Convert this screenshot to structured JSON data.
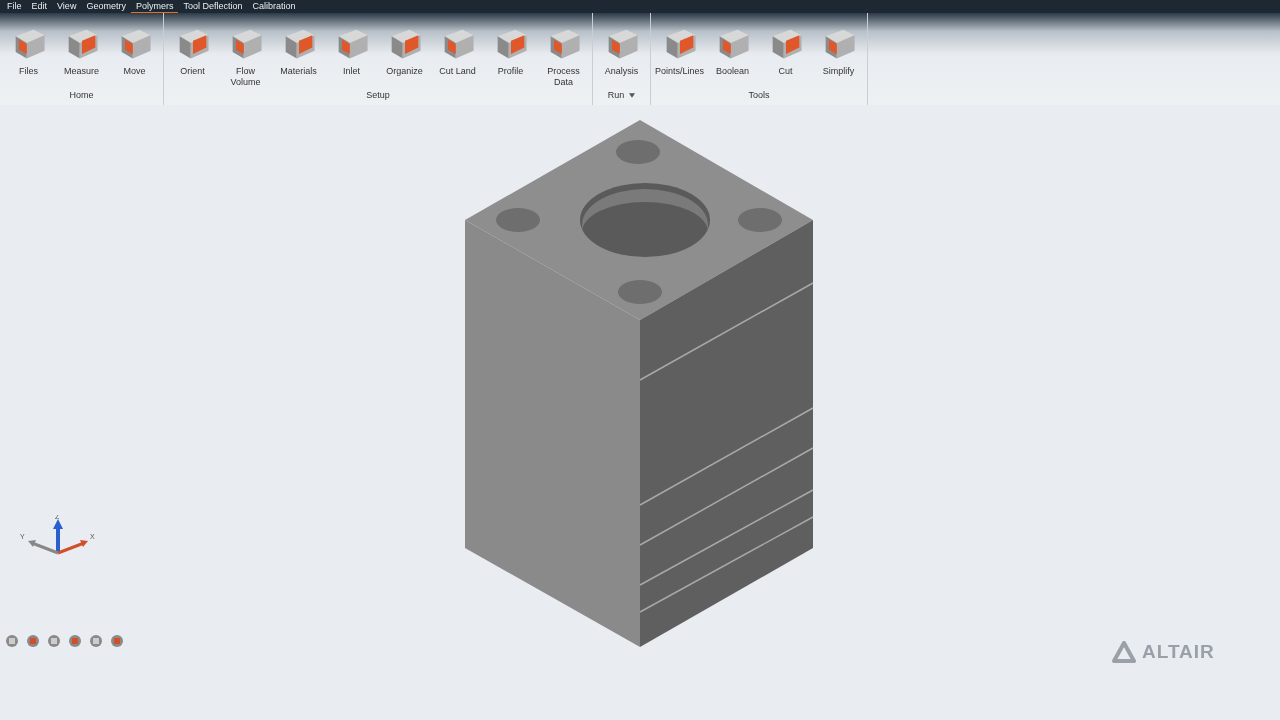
{
  "menu": [
    {
      "label": "File",
      "selected": false
    },
    {
      "label": "Edit",
      "selected": false
    },
    {
      "label": "View",
      "selected": false
    },
    {
      "label": "Geometry",
      "selected": false
    },
    {
      "label": "Polymers",
      "selected": true
    },
    {
      "label": "Tool Deflection",
      "selected": false
    },
    {
      "label": "Calibration",
      "selected": false
    }
  ],
  "ribbon": [
    {
      "label": "Home",
      "dropdown": false,
      "tools": [
        "Files",
        "Measure",
        "Move"
      ]
    },
    {
      "label": "Setup",
      "dropdown": false,
      "tools": [
        "Orient",
        "Flow Volume",
        "Materials",
        "Inlet",
        "Organize",
        "Cut Land",
        "Profile",
        "Process Data"
      ]
    },
    {
      "label": "Run",
      "dropdown": true,
      "tools": [
        "Analysis"
      ]
    },
    {
      "label": "Tools",
      "dropdown": false,
      "tools": [
        "Points/Lines",
        "Boolean",
        "Cut",
        "Simplify"
      ]
    }
  ],
  "triad": {
    "z": "Z",
    "y": "Y",
    "x": "X"
  },
  "logo": "ALTAIR"
}
